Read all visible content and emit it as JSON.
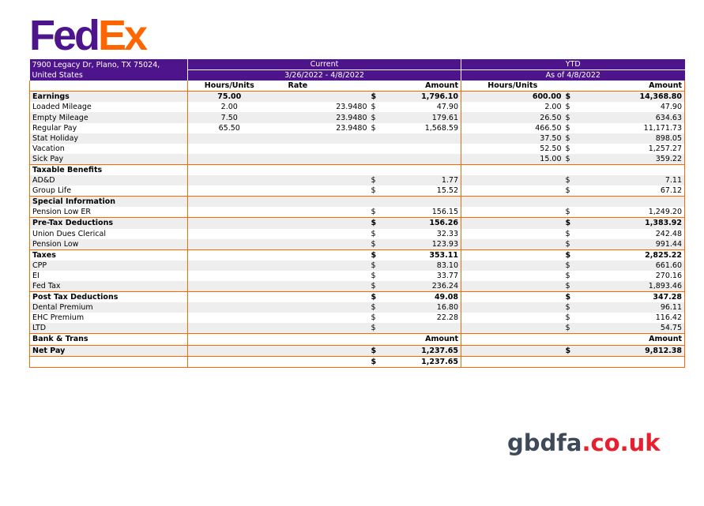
{
  "logo": {
    "part1": "Fed",
    "part2": "Ex"
  },
  "header": {
    "address": "7900 Legacy Dr, Plano, TX 75024, United States",
    "current_label": "Current",
    "ytd_label": "YTD",
    "current_period": "3/26/2022 - 4/8/2022",
    "ytd_period": "As of 4/8/2022"
  },
  "columns": {
    "hours_units": "Hours/Units",
    "rate": "Rate",
    "amount": "Amount",
    "ytd_hours_units": "Hours/Units",
    "ytd_amount": "Amount"
  },
  "rows": {
    "earnings": {
      "label": "Earnings",
      "hours": "75.00",
      "cur": "$",
      "amount": "1,796.10",
      "ytd_hours": "600.00",
      "ytd_cur": "$",
      "ytd_amount": "14,368.80"
    },
    "loaded_mileage": {
      "label": "Loaded Mileage",
      "hours": "2.00",
      "rate": "23.9480",
      "cur": "$",
      "amount": "47.90",
      "ytd_hours": "2.00",
      "ytd_cur": "$",
      "ytd_amount": "47.90"
    },
    "empty_mileage": {
      "label": "Empty Mileage",
      "hours": "7.50",
      "rate": "23.9480",
      "cur": "$",
      "amount": "179.61",
      "ytd_hours": "26.50",
      "ytd_cur": "$",
      "ytd_amount": "634.63"
    },
    "regular_pay": {
      "label": "Regular Pay",
      "hours": "65.50",
      "rate": "23.9480",
      "cur": "$",
      "amount": "1,568.59",
      "ytd_hours": "466.50",
      "ytd_cur": "$",
      "ytd_amount": "11,171.73"
    },
    "stat_holiday": {
      "label": "Stat Holiday",
      "ytd_hours": "37.50",
      "ytd_cur": "$",
      "ytd_amount": "898.05"
    },
    "vacation": {
      "label": "Vacation",
      "ytd_hours": "52.50",
      "ytd_cur": "$",
      "ytd_amount": "1,257.27"
    },
    "sick_pay": {
      "label": "Sick Pay",
      "ytd_hours": "15.00",
      "ytd_cur": "$",
      "ytd_amount": "359.22"
    },
    "taxable_benefits": {
      "label": "Taxable Benefits"
    },
    "add": {
      "label": "AD&D",
      "cur": "$",
      "amount": "1.77",
      "ytd_cur": "$",
      "ytd_amount": "7.11"
    },
    "group_life": {
      "label": "Group Life",
      "cur": "$",
      "amount": "15.52",
      "ytd_cur": "$",
      "ytd_amount": "67.12"
    },
    "special_information": {
      "label": "Special Information"
    },
    "pension_low_er": {
      "label": "Pension Low ER",
      "cur": "$",
      "amount": "156.15",
      "ytd_cur": "$",
      "ytd_amount": "1,249.20"
    },
    "pre_tax": {
      "label": "Pre-Tax Deductions",
      "cur": "$",
      "amount": "156.26",
      "ytd_cur": "$",
      "ytd_amount": "1,383.92"
    },
    "union_dues": {
      "label": "Union Dues Clerical",
      "cur": "$",
      "amount": "32.33",
      "ytd_cur": "$",
      "ytd_amount": "242.48"
    },
    "pension_low": {
      "label": "Pension Low",
      "cur": "$",
      "amount": "123.93",
      "ytd_cur": "$",
      "ytd_amount": "991.44"
    },
    "taxes": {
      "label": "Taxes",
      "cur": "$",
      "amount": "353.11",
      "ytd_cur": "$",
      "ytd_amount": "2,825.22"
    },
    "cpp": {
      "label": "CPP",
      "cur": "$",
      "amount": "83.10",
      "ytd_cur": "$",
      "ytd_amount": "661.60"
    },
    "ei": {
      "label": "EI",
      "cur": "$",
      "amount": "33.77",
      "ytd_cur": "$",
      "ytd_amount": "270.16"
    },
    "fed_tax": {
      "label": "Fed Tax",
      "cur": "$",
      "amount": "236.24",
      "ytd_cur": "$",
      "ytd_amount": "1,893.46"
    },
    "post_tax": {
      "label": "Post Tax Deductions",
      "cur": "$",
      "amount": "49.08",
      "ytd_cur": "$",
      "ytd_amount": "347.28"
    },
    "dental": {
      "label": "Dental Premium",
      "cur": "$",
      "amount": "16.80",
      "ytd_cur": "$",
      "ytd_amount": "96.11"
    },
    "ehc": {
      "label": "EHC Premium",
      "cur": "$",
      "amount": "22.28",
      "ytd_cur": "$",
      "ytd_amount": "116.42"
    },
    "ltd": {
      "label": "LTD",
      "cur": "$",
      "ytd_cur": "$",
      "ytd_amount": "54.75"
    },
    "bank_trans": {
      "label": "Bank & Trans",
      "amount": "Amount",
      "ytd_amount": "Amount"
    },
    "net_pay": {
      "label": "Net Pay",
      "cur": "$",
      "amount": "1,237.65",
      "ytd_cur": "$",
      "ytd_amount": "9,812.38"
    },
    "deposit": {
      "cur": "$",
      "amount": "1,237.65"
    }
  },
  "watermark": {
    "part1": "gbdfa",
    "part2": ".co.uk"
  },
  "colors": {
    "purple": "#4d148c",
    "orange": "#ff6600",
    "shade": "#eeeeee"
  }
}
